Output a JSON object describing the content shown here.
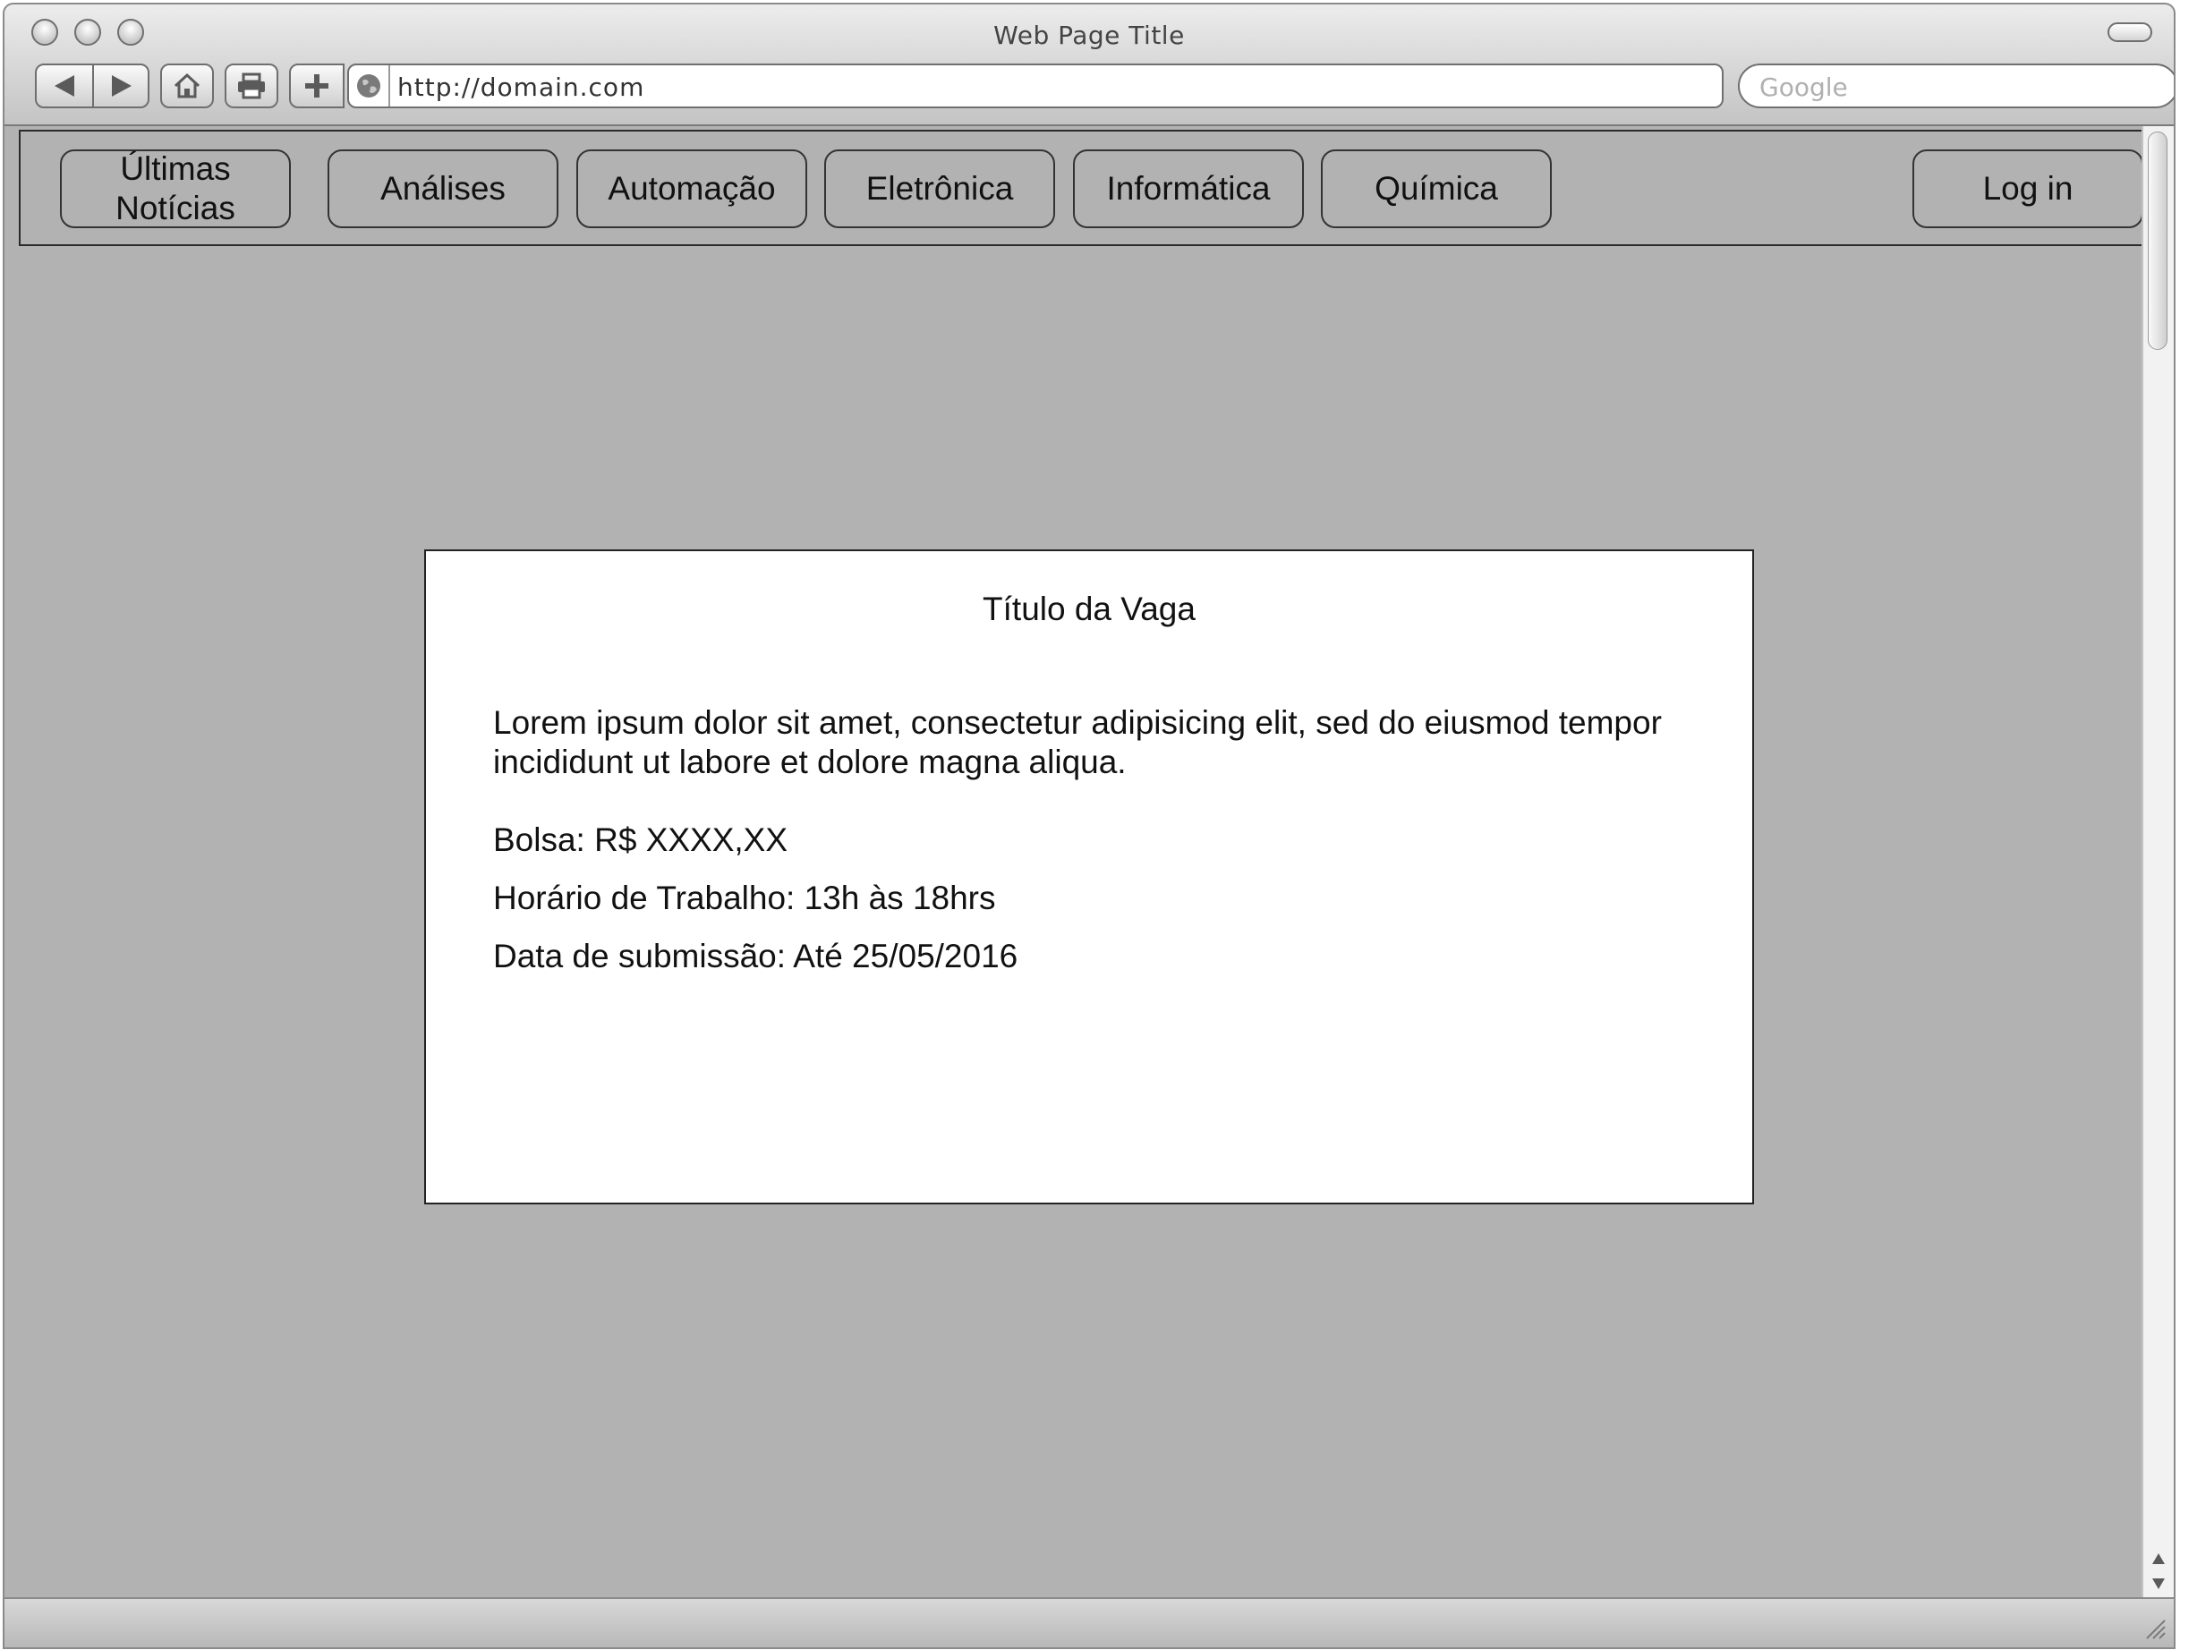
{
  "browser": {
    "window_title": "Web Page Title",
    "url": "http://domain.com",
    "search_placeholder": "Google",
    "toolbar_icons": [
      "back-arrow-icon",
      "forward-arrow-icon",
      "home-icon",
      "print-icon",
      "add-bookmark-icon",
      "globe-icon"
    ]
  },
  "nav": {
    "items": [
      {
        "line1": "Últimas",
        "line2": "Notícias"
      },
      {
        "label": "Análises"
      },
      {
        "label": "Automação"
      },
      {
        "label": "Eletrônica"
      },
      {
        "label": "Informática"
      },
      {
        "label": "Química"
      }
    ],
    "login": "Log in"
  },
  "job": {
    "title": "Título da Vaga",
    "description": "Lorem ipsum dolor sit amet, consectetur adipisicing elit, sed do eiusmod tempor incididunt ut labore et dolore magna aliqua.",
    "salary": "Bolsa: R$ XXXX,XX",
    "hours": "Horário de Trabalho: 13h às 18hrs",
    "deadline": "Data de submissão: Até 25/05/2016"
  },
  "colors": {
    "page_background": "#b2b2b2",
    "card_background": "#ffffff",
    "border": "#222222"
  }
}
